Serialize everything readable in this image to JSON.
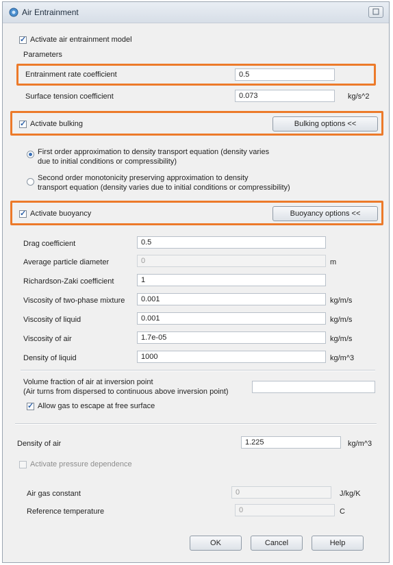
{
  "window": {
    "title": "Air Entrainment"
  },
  "activate_model": {
    "label": "Activate air entrainment model",
    "checked": true
  },
  "parameters": {
    "heading": "Parameters",
    "entrainment_rate": {
      "label": "Entrainment rate coefficient",
      "value": "0.5"
    },
    "surface_tension": {
      "label": "Surface tension coefficient",
      "value": "0.073",
      "unit": "kg/s^2"
    }
  },
  "bulking": {
    "label": "Activate bulking",
    "checked": true,
    "button": "Bulking options <<",
    "option1": {
      "line1": "First order approximation to density transport equation (density varies",
      "line2": "due to initial conditions or compressibility)",
      "selected": true
    },
    "option2": {
      "line1": "Second order monotonicity preserving approximation to density",
      "line2": "transport equation (density varies due to initial conditions or compressibility)",
      "selected": false
    }
  },
  "buoyancy": {
    "label": "Activate buoyancy",
    "checked": true,
    "button": "Buoyancy options <<",
    "fields": [
      {
        "label": "Drag coefficient",
        "value": "0.5",
        "unit": ""
      },
      {
        "label": "Average particle diameter",
        "value": "0",
        "unit": "m"
      },
      {
        "label": "Richardson-Zaki coefficient",
        "value": "1",
        "unit": ""
      },
      {
        "label": "Viscosity of two-phase mixture",
        "value": "0.001",
        "unit": "kg/m/s"
      },
      {
        "label": "Viscosity of liquid",
        "value": "0.001",
        "unit": "kg/m/s"
      },
      {
        "label": "Viscosity of air",
        "value": "1.7e-05",
        "unit": "kg/m/s"
      },
      {
        "label": "Density of liquid",
        "value": "1000",
        "unit": "kg/m^3"
      }
    ],
    "volume_fraction": {
      "line1": "Volume fraction of air at inversion point",
      "line2": "(Air turns from dispersed to continuous above inversion point)",
      "value": ""
    },
    "allow_escape": {
      "label": "Allow gas to escape at free surface",
      "checked": true
    }
  },
  "density_air": {
    "label": "Density of air",
    "value": "1.225",
    "unit": "kg/m^3"
  },
  "pressure": {
    "label": "Activate pressure dependence",
    "checked": false,
    "gas_constant": {
      "label": "Air gas constant",
      "value": "0",
      "unit": "J/kg/K"
    },
    "ref_temp": {
      "label": "Reference temperature",
      "value": "0",
      "unit": "C"
    }
  },
  "buttons": {
    "ok": "OK",
    "cancel": "Cancel",
    "help": "Help"
  },
  "colors": {
    "highlight": "#ec7a2a"
  }
}
